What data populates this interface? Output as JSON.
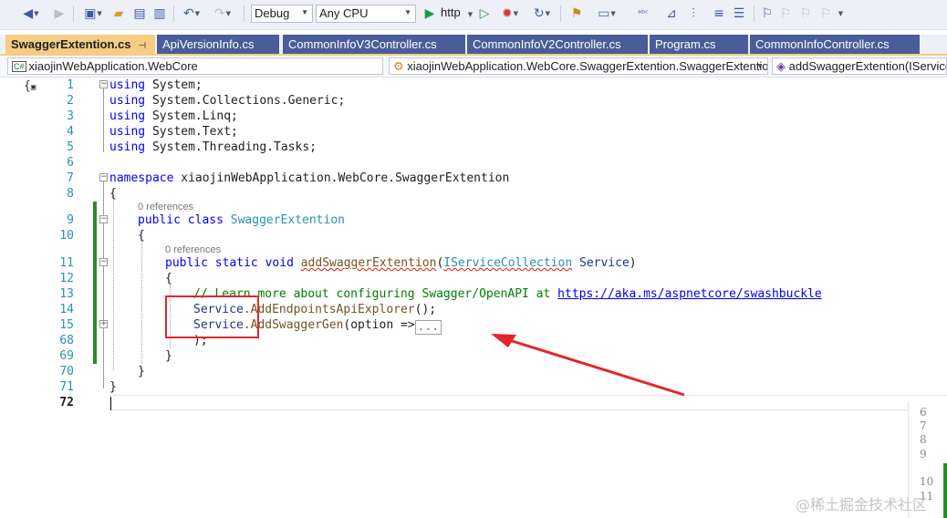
{
  "toolbar": {
    "config": "Debug",
    "platform": "Any CPU",
    "run_target": "http",
    "icons": [
      "back-icon",
      "forward-icon",
      "new-project-icon",
      "open-folder-icon",
      "save-icon",
      "save-all-icon",
      "undo-icon",
      "redo-icon",
      "start-icon",
      "start-without-debug-icon",
      "hot-reload-icon",
      "refresh-icon",
      "solution-explorer-icon",
      "window-icon",
      "spellcheck-icon",
      "step-icon",
      "bookmark-icon"
    ]
  },
  "tabs": [
    {
      "label": "SwaggerExtention.cs",
      "active": true
    },
    {
      "label": "ApiVersionInfo.cs"
    },
    {
      "label": "CommonInfoV3Controller.cs"
    },
    {
      "label": "CommonInfoV2Controller.cs"
    },
    {
      "label": "Program.cs"
    },
    {
      "label": "CommonInfoController.cs"
    }
  ],
  "tab_glyphs": {
    "pin": "⊣",
    "close": "✕"
  },
  "navbar": {
    "project": "xiaojinWebApplication.WebCore",
    "project_icon": "C#",
    "type": "xiaojinWebApplication.WebCore.SwaggerExtention.SwaggerExtention",
    "member": "addSwaggerExtention(IServiceCollection Service)"
  },
  "editor": {
    "line_numbers": [
      "1",
      "2",
      "3",
      "4",
      "5",
      "6",
      "7",
      "8",
      "9",
      "10",
      "11",
      "12",
      "13",
      "14",
      "15",
      "68",
      "69",
      "70",
      "71",
      "72"
    ],
    "current_line": "72",
    "codelens_class": "0 references",
    "codelens_method": "0 references",
    "code": {
      "using": "using",
      "ns1": "System;",
      "ns2": "System.Collections.Generic;",
      "ns3": "System.Linq;",
      "ns4": "System.Text;",
      "ns5": "System.Threading.Tasks;",
      "namespace_kw": "namespace",
      "namespace_name": "xiaojinWebApplication.WebCore.SwaggerExtention",
      "open_brace": "{",
      "close_brace": "}",
      "public": "public",
      "class_kw": "class",
      "class_name": "SwaggerExtention",
      "static": "static",
      "void": "void",
      "method_name": "addSwaggerExtention",
      "param_type": "IServiceCollection",
      "param_name": "Service",
      "comment": "// Learn more about configuring Swagger/OpenAPI at",
      "url": "https://aka.ms/aspnetcore/swashbuckle",
      "service": "Service",
      "call1": ".AddEndpointsApiExplorer",
      "call1_end": "();",
      "call2": ".AddSwaggerGen",
      "call2_args": "(option =>",
      "collapsed": "...",
      "close_call": ");"
    }
  },
  "minimap": {
    "numbers": [
      "6",
      "7",
      "8",
      "9",
      "10",
      "11"
    ]
  },
  "watermark": "@稀土掘金技术社区",
  "colors": {
    "annotation": "#e3262c",
    "tab_active": "#f5cc84",
    "tab_inactive": "#4a5d9a",
    "change_bar": "#2a8a2a"
  }
}
